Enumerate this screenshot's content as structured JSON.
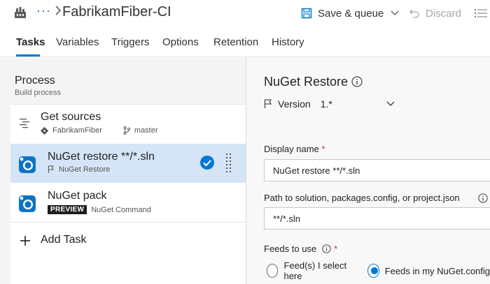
{
  "header": {
    "pipeline_name": "FabrikamFiber-CI",
    "ellipsis": "···",
    "save_label": "Save & queue",
    "discard_label": "Discard"
  },
  "tabs": [
    {
      "label": "Tasks",
      "active": true
    },
    {
      "label": "Variables",
      "active": false
    },
    {
      "label": "Triggers",
      "active": false
    },
    {
      "label": "Options",
      "active": false
    },
    {
      "label": "Retention",
      "active": false
    },
    {
      "label": "History",
      "active": false
    }
  ],
  "process": {
    "title": "Process",
    "subtitle": "Build process",
    "tasks": [
      {
        "title": "Get sources",
        "repo": "FabrikamFiber",
        "branch": "master",
        "icon": "get-sources-icon"
      },
      {
        "title": "NuGet restore **/*.sln",
        "meta": "NuGet Restore",
        "icon": "nuget-icon",
        "selected": true
      },
      {
        "title": "NuGet pack",
        "badge": "PREVIEW",
        "meta": "NuGet Command",
        "icon": "nuget-icon"
      }
    ],
    "add_task_label": "Add Task"
  },
  "details": {
    "title": "NuGet Restore",
    "version_label": "Version",
    "version_value": "1.*",
    "display_name_label": "Display name",
    "display_name_value": "NuGet restore **/*.sln",
    "path_label": "Path to solution, packages.config, or project.json",
    "path_value": "**/*.sln",
    "feeds_label": "Feeds to use",
    "feeds_options": [
      {
        "label": "Feed(s) I select here",
        "checked": false
      },
      {
        "label": "Feeds in my NuGet.config",
        "checked": true
      }
    ],
    "required_mark": "*"
  },
  "colors": {
    "accent": "#0078d4",
    "selected_row": "#d5e5f7",
    "required": "#c4314b",
    "panel_bg": "#f4f4f4"
  }
}
